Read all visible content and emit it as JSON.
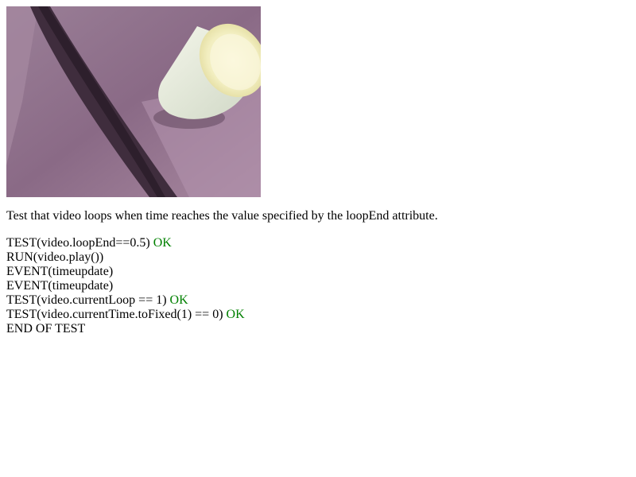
{
  "video": {
    "icon": "video-frame-cup"
  },
  "description": "Test that video loops when time reaches the value specified by the loopEnd attribute.",
  "log": [
    {
      "text": "TEST(video.loopEnd==0.5)",
      "status": "OK"
    },
    {
      "text": "RUN(video.play())",
      "status": ""
    },
    {
      "text": "EVENT(timeupdate)",
      "status": ""
    },
    {
      "text": "EVENT(timeupdate)",
      "status": ""
    },
    {
      "text": "TEST(video.currentLoop == 1)",
      "status": "OK"
    },
    {
      "text": "TEST(video.currentTime.toFixed(1) == 0)",
      "status": "OK"
    },
    {
      "text": "END OF TEST",
      "status": ""
    }
  ],
  "colors": {
    "ok": "#008000",
    "text": "#000000",
    "background": "#ffffff"
  }
}
